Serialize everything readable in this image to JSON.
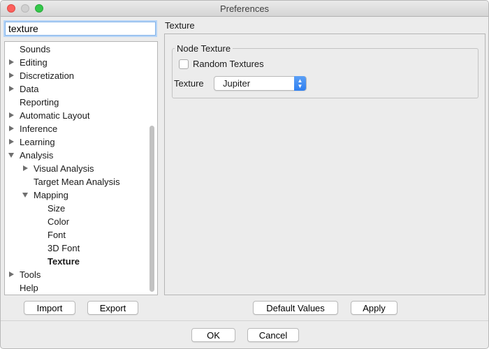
{
  "window": {
    "title": "Preferences"
  },
  "search": {
    "value": "texture"
  },
  "tree": {
    "items": [
      {
        "label": "Sounds",
        "bold": false
      },
      {
        "label": "Editing",
        "bold": false
      },
      {
        "label": "Discretization",
        "bold": false
      },
      {
        "label": "Data",
        "bold": false
      },
      {
        "label": "Reporting",
        "bold": false
      },
      {
        "label": "Automatic Layout",
        "bold": false
      },
      {
        "label": "Inference",
        "bold": false
      },
      {
        "label": "Learning",
        "bold": false
      },
      {
        "label": "Analysis",
        "bold": false
      },
      {
        "label": "Visual Analysis",
        "bold": false
      },
      {
        "label": "Target Mean Analysis",
        "bold": false
      },
      {
        "label": "Mapping",
        "bold": false
      },
      {
        "label": "Size",
        "bold": false
      },
      {
        "label": "Color",
        "bold": false
      },
      {
        "label": "Font",
        "bold": false
      },
      {
        "label": "3D Font",
        "bold": false
      },
      {
        "label": "Texture",
        "bold": true
      },
      {
        "label": "Tools",
        "bold": false
      },
      {
        "label": "Help",
        "bold": false
      }
    ]
  },
  "left_buttons": {
    "import_label": "Import",
    "export_label": "Export"
  },
  "panel": {
    "section_title": "Texture",
    "group_title": "Node Texture",
    "random_textures_label": "Random Textures",
    "random_textures_checked": false,
    "texture_label": "Texture",
    "texture_value": "Jupiter"
  },
  "panel_buttons": {
    "default_values_label": "Default Values",
    "apply_label": "Apply"
  },
  "dialog_buttons": {
    "ok_label": "OK",
    "cancel_label": "Cancel"
  },
  "colors": {
    "accent": "#2f7ff0",
    "focus_ring": "#84b4e9",
    "close": "#fc605c",
    "maximize": "#34c84a"
  }
}
